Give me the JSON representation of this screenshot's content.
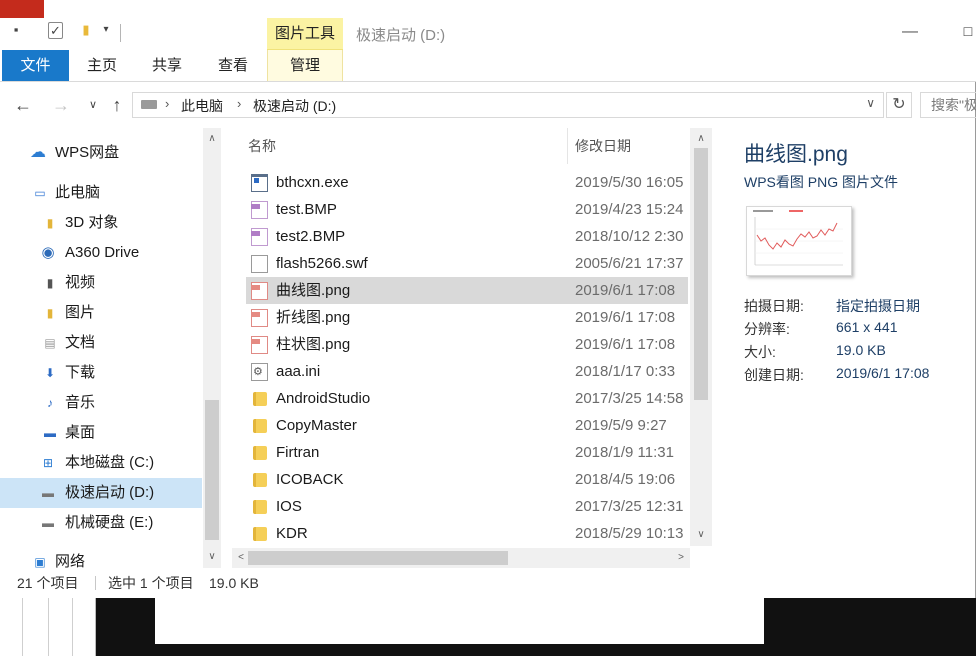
{
  "title_bar": {
    "context_tab": "图片工具",
    "window_title": "极速启动 (D:)"
  },
  "ribbon": {
    "tabs": [
      "文件",
      "主页",
      "共享",
      "查看",
      "管理"
    ]
  },
  "address_bar": {
    "segments": [
      "此电脑",
      "极速启动 (D:)"
    ],
    "search_placeholder": "搜索\"极速启动 (D:)\""
  },
  "nav_pane": {
    "items": [
      {
        "label": "WPS网盘",
        "icon": "cloud-icon"
      },
      {
        "label": "此电脑",
        "icon": "computer-icon"
      },
      {
        "label": "3D 对象",
        "icon": "folder-3d-icon"
      },
      {
        "label": "A360 Drive",
        "icon": "a360-icon"
      },
      {
        "label": "视频",
        "icon": "video-folder-icon"
      },
      {
        "label": "图片",
        "icon": "pictures-folder-icon"
      },
      {
        "label": "文档",
        "icon": "documents-folder-icon"
      },
      {
        "label": "下载",
        "icon": "downloads-folder-icon"
      },
      {
        "label": "音乐",
        "icon": "music-folder-icon"
      },
      {
        "label": "桌面",
        "icon": "desktop-folder-icon"
      },
      {
        "label": "本地磁盘 (C:)",
        "icon": "windows-drive-icon"
      },
      {
        "label": "极速启动 (D:)",
        "icon": "drive-icon"
      },
      {
        "label": "机械硬盘 (E:)",
        "icon": "drive-icon"
      },
      {
        "label": "网络",
        "icon": "network-icon"
      }
    ]
  },
  "file_list": {
    "columns": {
      "name": "名称",
      "date": "修改日期"
    },
    "rows": [
      {
        "name": "bthcxn.exe",
        "date": "2019/5/30 16:05",
        "type": "exe"
      },
      {
        "name": "test.BMP",
        "date": "2019/4/23 15:24",
        "type": "bmp"
      },
      {
        "name": "test2.BMP",
        "date": "2018/10/12 2:30",
        "type": "bmp"
      },
      {
        "name": "flash5266.swf",
        "date": "2005/6/21 17:37",
        "type": "doc"
      },
      {
        "name": "曲线图.png",
        "date": "2019/6/1 17:08",
        "type": "png"
      },
      {
        "name": "折线图.png",
        "date": "2019/6/1 17:08",
        "type": "png"
      },
      {
        "name": "柱状图.png",
        "date": "2019/6/1 17:08",
        "type": "png"
      },
      {
        "name": "aaa.ini",
        "date": "2018/1/17 0:33",
        "type": "ini"
      },
      {
        "name": "AndroidStudio",
        "date": "2017/3/25 14:58",
        "type": "folder"
      },
      {
        "name": "CopyMaster",
        "date": "2019/5/9 9:27",
        "type": "folder"
      },
      {
        "name": "Firtran",
        "date": "2018/1/9 11:31",
        "type": "folder"
      },
      {
        "name": "ICOBACK",
        "date": "2018/4/5 19:06",
        "type": "folder"
      },
      {
        "name": "IOS",
        "date": "2017/3/25 12:31",
        "type": "folder"
      },
      {
        "name": "KDR",
        "date": "2018/5/29 10:13",
        "type": "folder"
      }
    ]
  },
  "details_pane": {
    "filename": "曲线图.png",
    "filetype": "WPS看图 PNG 图片文件",
    "properties": [
      {
        "label": "拍摄日期:",
        "value": "指定拍摄日期"
      },
      {
        "label": "分辨率:",
        "value": "661 x 441"
      },
      {
        "label": "大小:",
        "value": "19.0 KB"
      },
      {
        "label": "创建日期:",
        "value": "2019/6/1 17:08"
      }
    ]
  },
  "status_bar": {
    "item_count": "21 个项目",
    "selection": "选中 1 个项目",
    "selection_size": "19.0 KB"
  },
  "colors": {
    "file_tab": "#1979ca",
    "context_tab": "#fbf3a3",
    "selection": "#cce4f7",
    "details_text": "#1e3f66"
  }
}
